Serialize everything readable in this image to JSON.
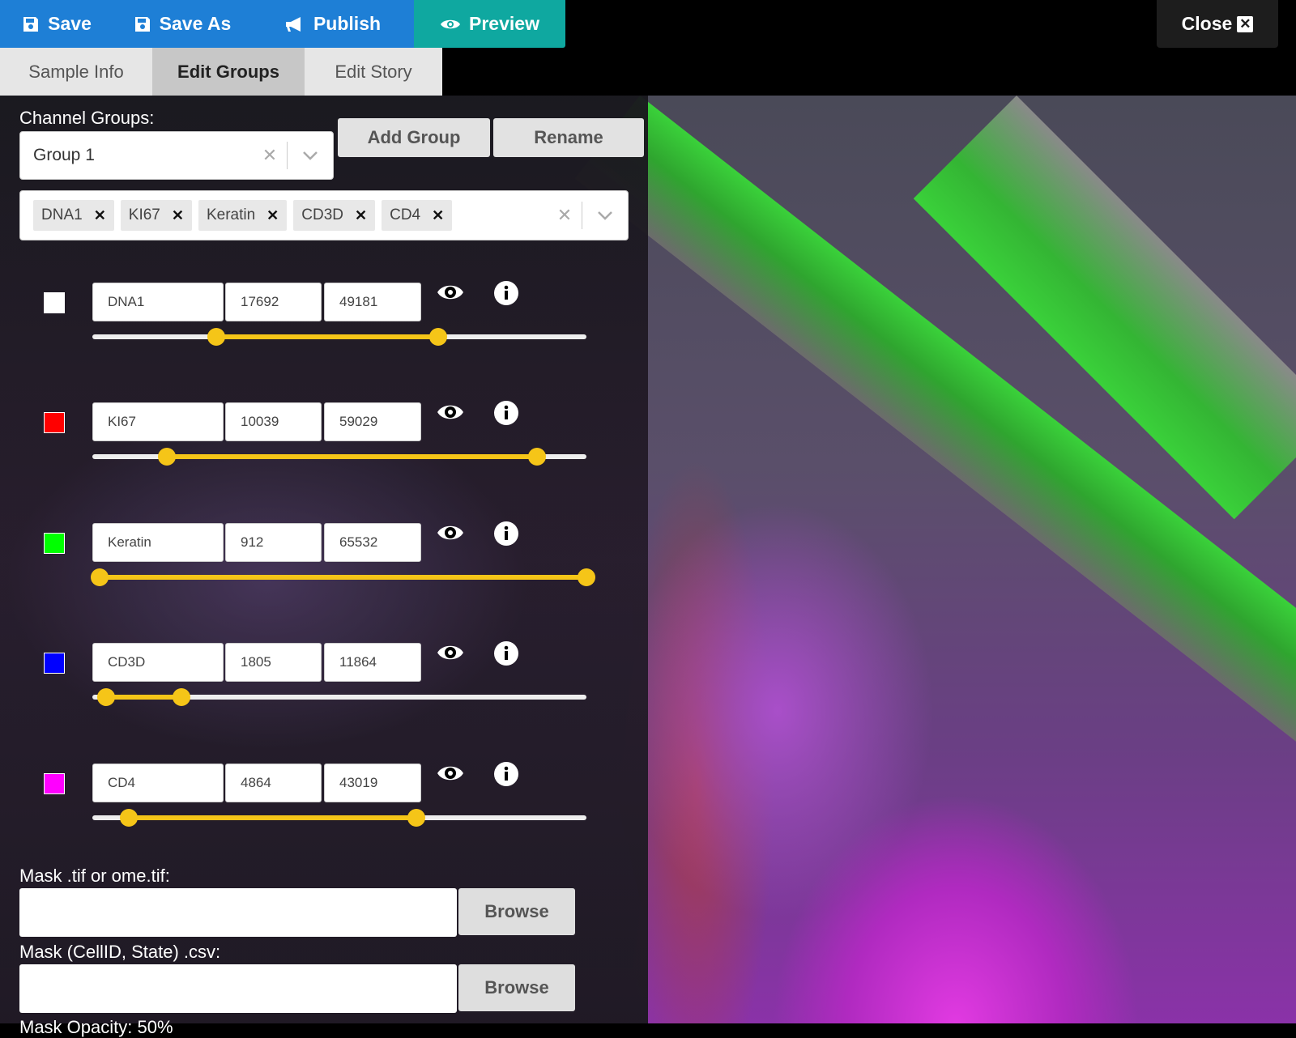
{
  "toolbar": {
    "save": "Save",
    "save_as": "Save As",
    "publish": "Publish",
    "preview": "Preview",
    "close": "Close"
  },
  "tabs": [
    {
      "label": "Sample Info",
      "active": false
    },
    {
      "label": "Edit Groups",
      "active": true
    },
    {
      "label": "Edit Story",
      "active": false
    }
  ],
  "groups": {
    "label": "Channel Groups:",
    "selected": "Group 1",
    "add_button": "Add Group",
    "rename_button": "Rename",
    "chips": [
      "DNA1",
      "KI67",
      "Keratin",
      "CD3D",
      "CD4"
    ]
  },
  "channels": [
    {
      "name": "DNA1",
      "min": "17692",
      "max": "49181",
      "color": "#ffffff",
      "slider_low": 0.25,
      "slider_high": 0.7
    },
    {
      "name": "KI67",
      "min": "10039",
      "max": "59029",
      "color": "#ff0000",
      "slider_low": 0.15,
      "slider_high": 0.9
    },
    {
      "name": "Keratin",
      "min": "912",
      "max": "65532",
      "color": "#00ff00",
      "slider_low": 0.014,
      "slider_high": 1.0
    },
    {
      "name": "CD3D",
      "min": "1805",
      "max": "11864",
      "color": "#0000ff",
      "slider_low": 0.028,
      "slider_high": 0.18
    },
    {
      "name": "CD4",
      "min": "4864",
      "max": "43019",
      "color": "#ff00ff",
      "slider_low": 0.074,
      "slider_high": 0.656
    }
  ],
  "mask": {
    "tif_label": "Mask .tif or ome.tif:",
    "tif_value": "",
    "csv_label": "Mask (CellID, State) .csv:",
    "csv_value": "",
    "browse": "Browse",
    "opacity_label": "Mask Opacity: 50%"
  },
  "colors": {
    "toolbar_blue": "#1e7fd6",
    "preview_teal": "#0fa8a0",
    "slider_yellow": "#f5c518"
  }
}
